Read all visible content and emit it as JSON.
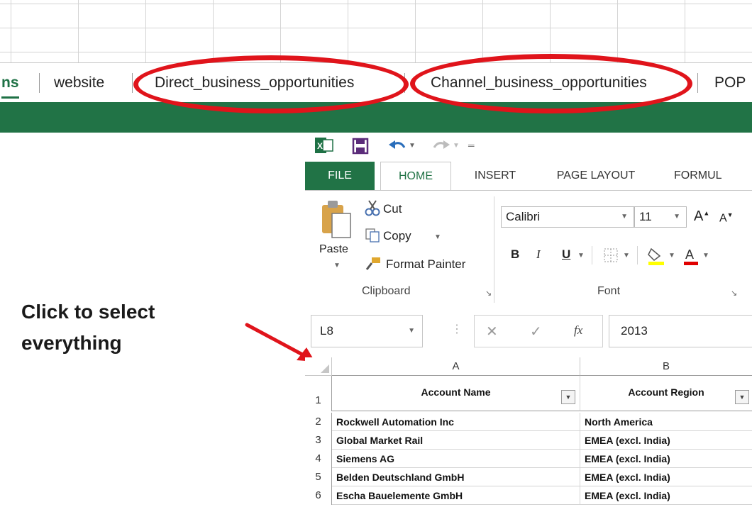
{
  "sheet_tabs": [
    {
      "label": "ns",
      "active": true
    },
    {
      "label": "website",
      "active": false
    },
    {
      "label": "Direct_business_opportunities",
      "active": false,
      "highlighted": true
    },
    {
      "label": "Channel_business_opportunities",
      "active": false,
      "highlighted": true
    },
    {
      "label": "POP",
      "active": false
    }
  ],
  "annotation": {
    "line1": "Click to select",
    "line2": "everything"
  },
  "ribbon": {
    "tabs": [
      "FILE",
      "HOME",
      "INSERT",
      "PAGE LAYOUT",
      "FORMUL"
    ],
    "clipboard": {
      "paste": "Paste",
      "cut": "Cut",
      "copy": "Copy",
      "format_painter": "Format Painter",
      "group_label": "Clipboard"
    },
    "font": {
      "family": "Calibri",
      "size": "11",
      "bold": "B",
      "italic": "I",
      "underline": "U",
      "group_label": "Font"
    }
  },
  "formula_bar": {
    "name_box": "L8",
    "fx": "fx",
    "value": "2013"
  },
  "sheet": {
    "columns": [
      "A",
      "B"
    ],
    "header_row": {
      "row": "1",
      "cells": [
        "Account Name",
        "Account Region"
      ]
    },
    "rows": [
      {
        "row": "2",
        "cells": [
          "Rockwell Automation Inc",
          "North America"
        ]
      },
      {
        "row": "3",
        "cells": [
          "Global Market Rail",
          "EMEA (excl. India)"
        ]
      },
      {
        "row": "4",
        "cells": [
          "Siemens AG",
          "EMEA (excl. India)"
        ]
      },
      {
        "row": "5",
        "cells": [
          "Belden Deutschland GmbH",
          "EMEA (excl. India)"
        ]
      },
      {
        "row": "6",
        "cells": [
          "Escha Bauelemente GmbH",
          "EMEA (excl. India)"
        ]
      }
    ]
  },
  "colors": {
    "excel_green": "#217346",
    "annotation_red": "#e0141b"
  }
}
